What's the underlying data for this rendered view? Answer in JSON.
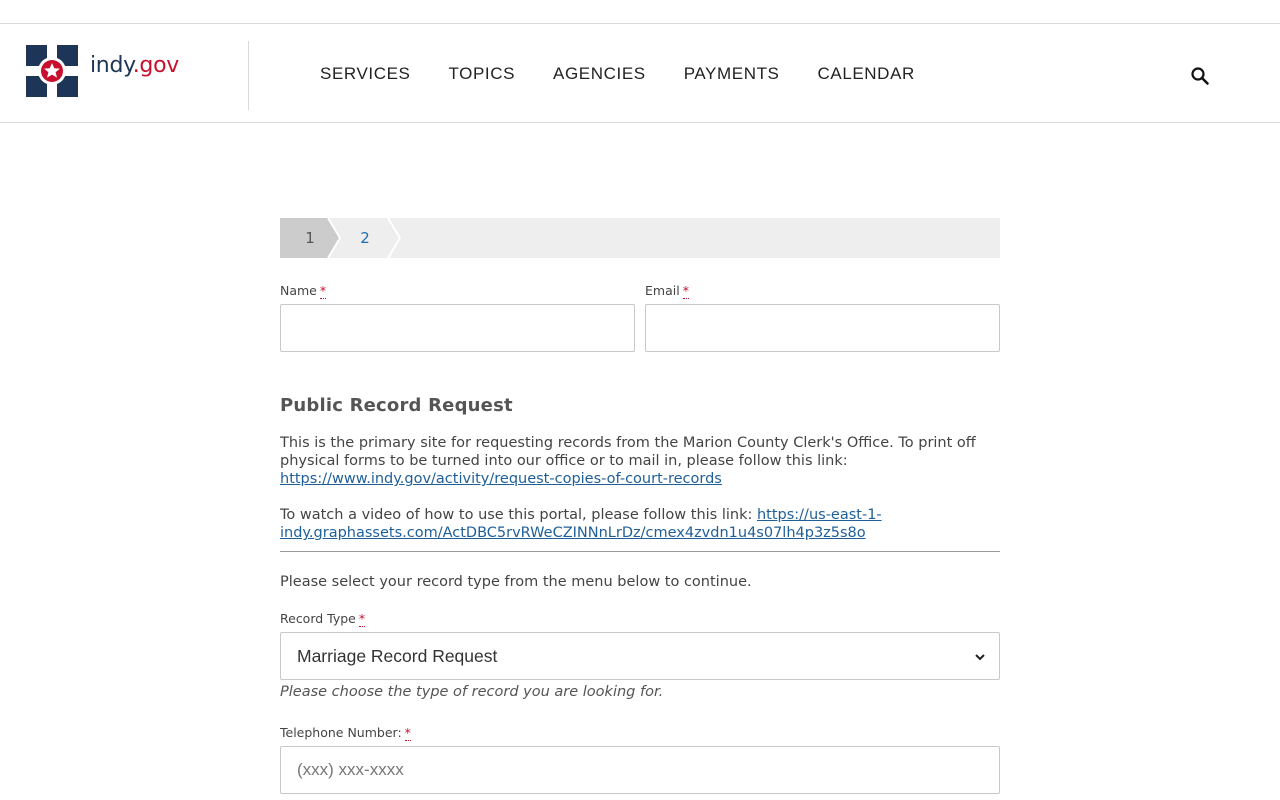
{
  "header": {
    "logo": {
      "part1": "indy",
      "part2": ".gov"
    },
    "nav": [
      "SERVICES",
      "TOPICS",
      "AGENCIES",
      "PAYMENTS",
      "CALENDAR"
    ],
    "icon": "search-icon"
  },
  "stepper": {
    "steps": [
      "1",
      "2"
    ],
    "current": 1
  },
  "fields": {
    "name_label": "Name",
    "email_label": "Email",
    "required_mark": "*"
  },
  "section": {
    "title": "Public Record Request",
    "p1_text": "This is the primary site for requesting records from the Marion County Clerk's Office. To print off physical forms to be turned into our office or to mail in, please follow this link:",
    "p1_link": "https://www.indy.gov/activity/request-copies-of-court-records",
    "p2_text": "To watch a video of how to use this portal, please follow this link:",
    "p2_link_a": "https://us-east-1-",
    "p2_link_b": "indy.graphassets.com/ActDBC5rvRWeCZINNnLrDz/cmex4zvdn1u4s07lh4p3z5s8o",
    "p3_text": "Please select your record type from the menu below to continue."
  },
  "record_type": {
    "label": "Record Type",
    "selected": "Marriage Record Request",
    "help": "Please choose the type of record you are looking for."
  },
  "phone": {
    "label": "Telephone Number:",
    "placeholder": "(xxx) xxx-xxxx"
  },
  "colors": {
    "brand_navy": "#1d3557",
    "brand_red": "#c8102e",
    "link": "#1f5f99",
    "step_active": "#cccccc"
  }
}
